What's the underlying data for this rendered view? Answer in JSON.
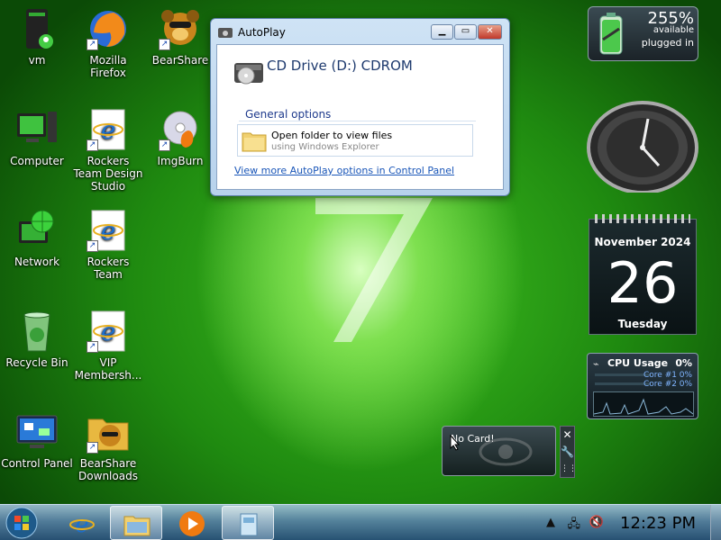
{
  "desktop": {
    "icons": [
      {
        "label": "vm"
      },
      {
        "label": "Mozilla Firefox"
      },
      {
        "label": "BearShare"
      },
      {
        "label": "Computer"
      },
      {
        "label": "Rockers Team Design Studio"
      },
      {
        "label": "ImgBurn"
      },
      {
        "label": "Network"
      },
      {
        "label": "Rockers Team"
      },
      {
        "label": "Recycle Bin"
      },
      {
        "label": "VIP Membersh..."
      },
      {
        "label": "Control Panel"
      },
      {
        "label": "BearShare Downloads"
      }
    ]
  },
  "autoplay": {
    "title": "AutoPlay",
    "drive_title": "CD Drive (D:) CDROM",
    "section": "General options",
    "option_main": "Open folder to view files",
    "option_sub": "using Windows Explorer",
    "more_link": "View more AutoPlay options in Control Panel"
  },
  "gadgets": {
    "battery": {
      "percent": "255%",
      "available": "available",
      "status": "plugged in"
    },
    "calendar": {
      "month": "November 2024",
      "day": "26",
      "weekday": "Tuesday"
    },
    "cpu": {
      "title": "CPU Usage",
      "value": "0%",
      "core1_label": "Core #1",
      "core1": "0%",
      "core2_label": "Core #2",
      "core2": "0%"
    },
    "media": {
      "text": "No Card!"
    }
  },
  "taskbar": {
    "time": "12:23 PM"
  },
  "colors": {
    "accent": "#1a56b8",
    "desktop_green": "#1f8a10"
  }
}
